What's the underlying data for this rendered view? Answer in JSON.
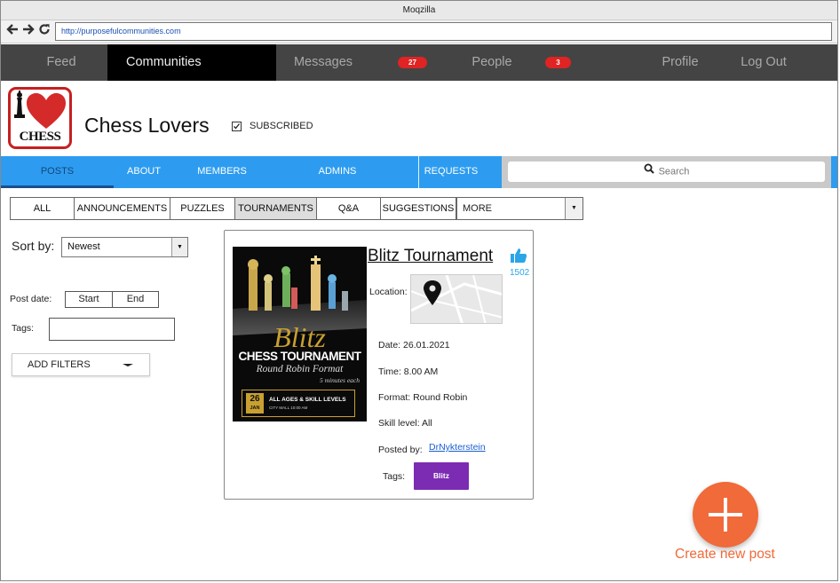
{
  "window": {
    "title": "Moqzilla"
  },
  "browser": {
    "url": "http://purposefulcommunities.com",
    "back_icon": "arrow-left",
    "forward_icon": "arrow-right",
    "reload_icon": "reload"
  },
  "main_nav": {
    "feed": "Feed",
    "communities": "Communities",
    "messages": "Messages",
    "messages_badge": "27",
    "people": "People",
    "people_badge": "3",
    "profile": "Profile",
    "logout": "Log Out",
    "badge_color": "#e02323"
  },
  "community": {
    "logo_text": "CHESS",
    "name": "Chess Lovers",
    "subscribed_label": "SUBSCRIBED",
    "subscribed_checked": "☑"
  },
  "sub_nav": {
    "posts": "POSTS",
    "about": "ABOUT",
    "members": "MEMBERS",
    "admins": "ADMINS",
    "requests": "REQUESTS",
    "search_placeholder": "Search",
    "accent_color": "#2d9cf0"
  },
  "filter_tabs": {
    "all": "ALL",
    "announcements": "ANNOUNCEMENTS",
    "puzzles": "PUZZLES",
    "tournaments": "TOURNAMENTS",
    "qa": "Q&A",
    "suggestions": "SUGGESTIONS",
    "more": "MORE"
  },
  "sidebar": {
    "sort_label": "Sort by:",
    "sort_value": "Newest",
    "post_date_label": "Post date:",
    "start": "Start",
    "end": "End",
    "tags_label": "Tags:",
    "add_filters": "ADD FILTERS"
  },
  "post": {
    "title": "Blitz Tournament",
    "likes": "1502",
    "location_label": "Location:",
    "date": "Date:  26.01.2021",
    "time": "Time: 8.00 AM",
    "format": "Format: Round Robin",
    "skill": "Skill level: All",
    "posted_by_label": "Posted by:",
    "author": "DrNykterstein",
    "tags_label": "Tags:",
    "tag": "Blitz",
    "tag_color": "#7c2cb2",
    "poster": {
      "script_title": "Blitz",
      "headline": "CHESS TOURNAMENT",
      "format": "Round Robin Format",
      "minutes": "5 minutes each",
      "day": "26",
      "month": "JAN",
      "line1": "ALL AGES & SKILL LEVELS",
      "line2": "CITY MALL 10:00 AM"
    }
  },
  "fab": {
    "label": "Create new post",
    "color": "#f06a3a"
  }
}
